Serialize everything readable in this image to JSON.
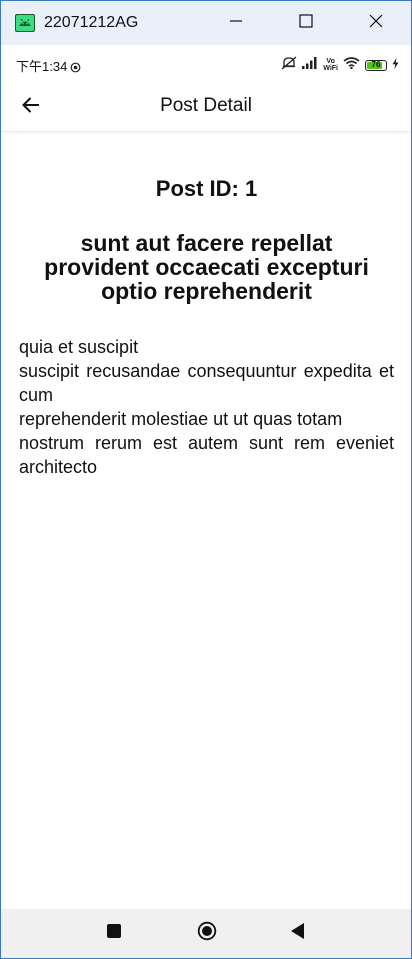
{
  "window": {
    "title": "22071212AG"
  },
  "status_bar": {
    "time": "下午1:34",
    "wifi_label_top": "Vo",
    "wifi_label_bottom": "WiFi",
    "battery_level": "76"
  },
  "app_bar": {
    "title": "Post Detail"
  },
  "post": {
    "id_label": "Post ID: 1",
    "title": "sunt aut facere repellat\nprovident occaecati excepturi\noptio reprehenderit",
    "body": "quia et suscipit\nsuscipit recusandae consequuntur expedita et cum\nreprehenderit molestiae ut ut quas totam\nnostrum rerum est autem sunt rem eveniet architecto"
  },
  "icons": {
    "app": "android-icon",
    "minimize": "minimize-icon",
    "maximize": "maximize-icon",
    "close": "close-icon",
    "back_arrow": "arrow-left-icon",
    "nav_recents": "square-icon",
    "nav_home": "circle-icon",
    "nav_back": "triangle-icon"
  },
  "colors": {
    "titlebar_bg": "#e9f0fa",
    "app_icon_green": "#3ddc84",
    "battery_green": "#52c41a",
    "nav_bar_bg": "#f0f0f0"
  }
}
